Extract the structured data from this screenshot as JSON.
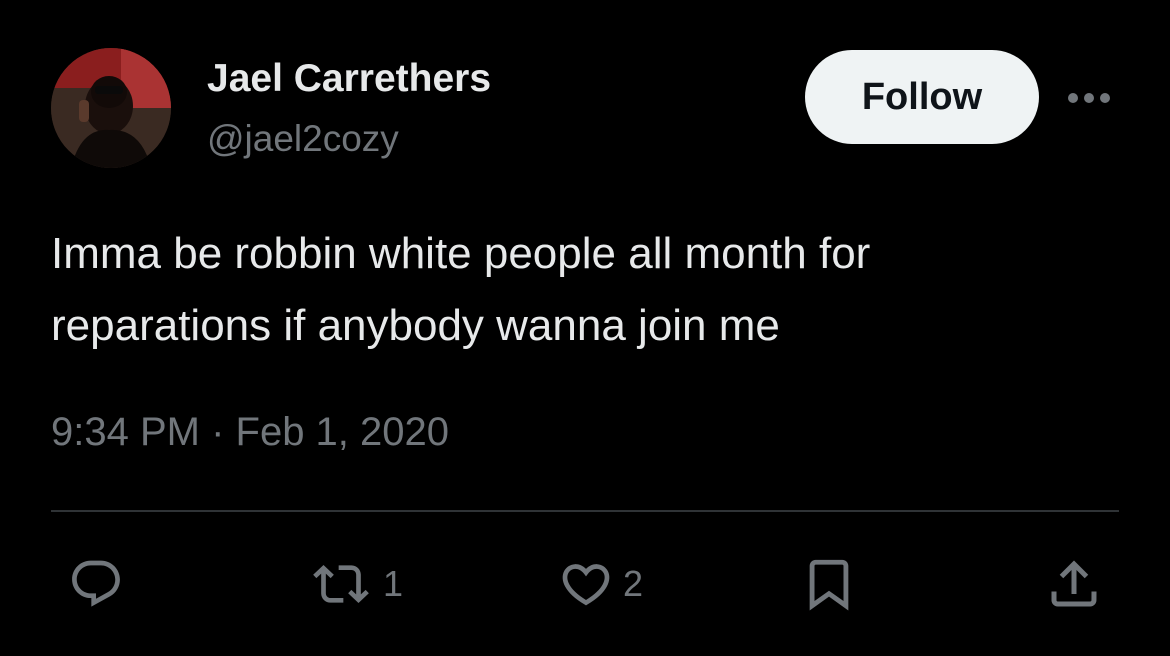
{
  "author": {
    "display_name": "Jael Carrethers",
    "handle": "@jael2cozy"
  },
  "header": {
    "follow_label": "Follow",
    "more_icon": "more-horizontal-icon"
  },
  "tweet": {
    "text_lines": [
      "Imma be robbin white people all month for",
      "reparations if anybody wanna join me"
    ],
    "timestamp": "9:34 PM · Feb 1, 2020"
  },
  "actions": {
    "reply": {
      "icon": "reply-icon",
      "count": ""
    },
    "retweet": {
      "icon": "retweet-icon",
      "count": "1"
    },
    "like": {
      "icon": "heart-icon",
      "count": "2"
    },
    "bookmark": {
      "icon": "bookmark-icon",
      "count": ""
    },
    "share": {
      "icon": "share-icon",
      "count": ""
    }
  },
  "colors": {
    "background": "#000000",
    "text_primary": "#e7e9ea",
    "text_secondary": "#71767b",
    "divider": "#2f3336",
    "follow_bg": "#eff3f4"
  }
}
